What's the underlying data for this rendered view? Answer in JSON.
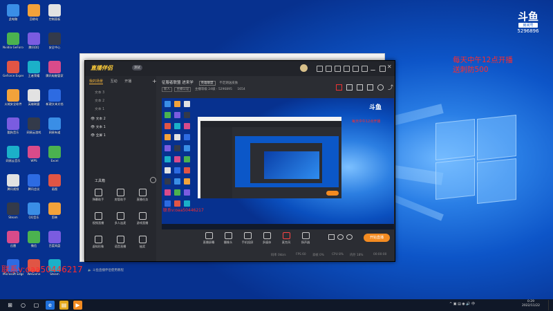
{
  "desktop": {
    "icons_col1": [
      "此电脑",
      "Nvidia GeForce Experience",
      "GeForce Experience",
      "火绒安全软件",
      "酷狗音乐",
      "网易云音乐",
      "腾讯视频",
      "Steam",
      "迅雷",
      "Microsoft Edge"
    ],
    "icons_col2": [
      "回收站",
      "腾讯QQ",
      "王者荣耀",
      "英雄联盟",
      "网易云游戏",
      "WPS",
      "腾讯会议",
      "QQ音乐",
      "微信",
      "WeGame"
    ],
    "icons_col3": [
      "控制面板",
      "安全中心",
      "腾讯电脑管家",
      "新建文本文档",
      "网易有道",
      "Excel",
      "画图",
      "剪映",
      "百度网盘",
      "Steam"
    ]
  },
  "overlay": {
    "douyu_logo": "斗鱼",
    "douyu_sub": "房间号",
    "douyu_room": "5296896",
    "promo_line1": "每天中午12点开播",
    "promo_line2": "送刺防500",
    "contact": "联系v:oaa50446217"
  },
  "app": {
    "logo": "直播伴侣",
    "version": "测试",
    "left_tabs": [
      "我的场景",
      "互动",
      "开播"
    ],
    "scenes": [
      "文本 3",
      "文本 2",
      "文本 1",
      "文本 2",
      "文本 1",
      "全屏 1"
    ],
    "tools_title": "工具箱",
    "tools": [
      [
        "弹幕助手",
        "房管助手",
        "直播任务"
      ],
      [
        "视频直播",
        "多人连麦",
        "游戏直播"
      ],
      [
        "虚拟形象",
        "语音直播",
        "抽奖"
      ]
    ],
    "notice": "斗鱼直播伴侣使用教程",
    "stream_title": "征服者联盟 进来学",
    "stream_category": "英雄联盟",
    "stream_topic": "不定期送皮肤",
    "stream_badges": [
      "新人",
      "主播认证"
    ],
    "stream_stats": "主播等级 24级 · 5296895",
    "fans_count": "1654",
    "bottom_items": [
      "直播屏幕",
      "摄像头",
      "手机投屏",
      "多媒体",
      "麦克风",
      "扬声器"
    ],
    "live_button": "开始直播",
    "status_items": [
      "码率 0kb/s",
      "FPS 60",
      "丢帧 0%",
      "CPU 8%",
      "内存 18%"
    ],
    "status_time": "00:00:00"
  },
  "preview_overlay": {
    "douyu_logo": "斗鱼",
    "promo": "每天中午12点开播",
    "contact": "联系v:oaa50446217"
  },
  "taskbar": {
    "time": "0:29",
    "date": "2022/11/22"
  },
  "colors": {
    "accent": "#f38b21",
    "brand_gold": "#ffce3a",
    "overlay_red": "#ff2b2b",
    "wallpaper": "#0d55c8"
  }
}
